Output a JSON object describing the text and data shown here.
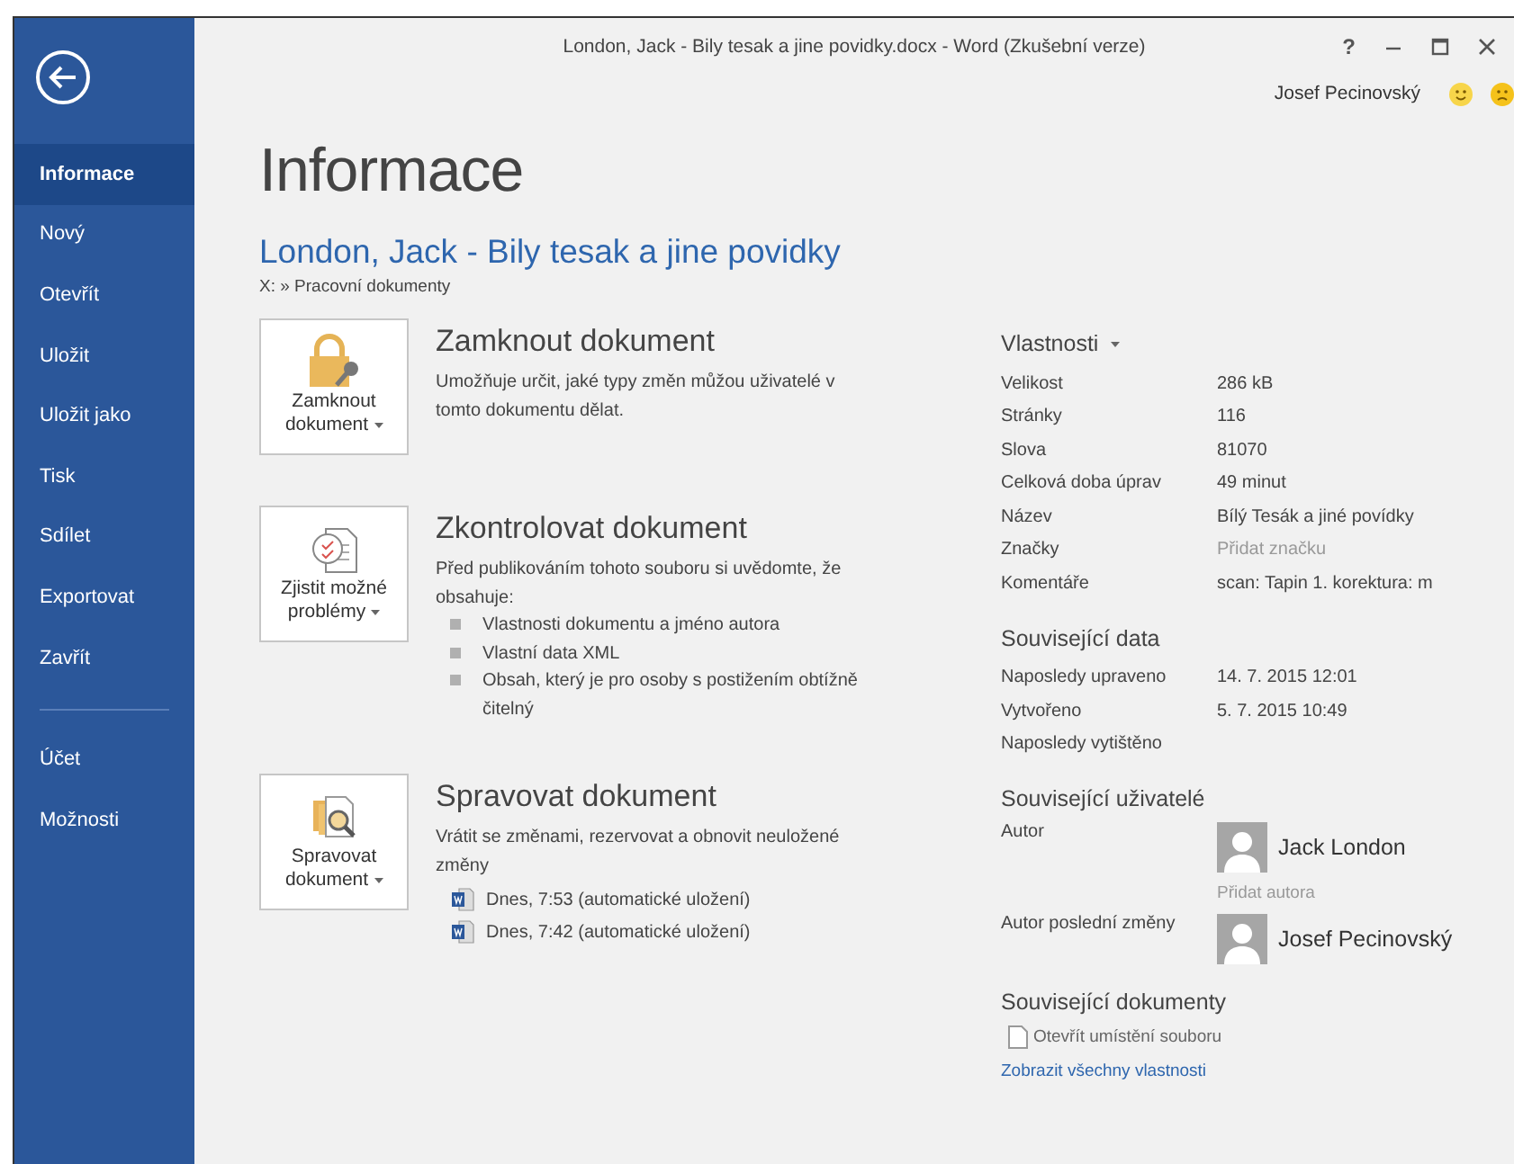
{
  "window": {
    "title": "London, Jack - Bily tesak a jine povidky.docx - Word (Zkušební verze)",
    "help": "?"
  },
  "user": {
    "name": "Josef Pecinovský"
  },
  "sidebar": {
    "items": [
      {
        "label": "Informace",
        "selected": true
      },
      {
        "label": "Nový",
        "selected": false
      },
      {
        "label": "Otevřít",
        "selected": false
      },
      {
        "label": "Uložit",
        "selected": false
      },
      {
        "label": "Uložit jako",
        "selected": false
      },
      {
        "label": "Tisk",
        "selected": false
      },
      {
        "label": "Sdílet",
        "selected": false
      },
      {
        "label": "Exportovat",
        "selected": false
      },
      {
        "label": "Zavřít",
        "selected": false
      }
    ],
    "bottom_items": [
      {
        "label": "Účet",
        "selected": false
      },
      {
        "label": "Možnosti",
        "selected": false
      }
    ]
  },
  "page": {
    "heading": "Informace",
    "document_title": "London, Jack - Bily tesak a jine povidky",
    "path": "X: » Pracovní dokumenty"
  },
  "sections": [
    {
      "kind": "lock",
      "button_label": "Zamknout dokument",
      "title": "Zamknout dokument",
      "description": "Umožňuje určit, jaké typy změn můžou uživatelé v tomto dokumentu dělat."
    },
    {
      "kind": "inspect",
      "button_label": "Zjistit možné problémy",
      "title": "Zkontrolovat dokument",
      "description": "Před publikováním tohoto souboru si uvědomte, že obsahuje:",
      "bullets": [
        "Vlastnosti dokumentu a jméno autora",
        "Vlastní data XML",
        "Obsah, který je pro osoby s postižením obtížně čitelný"
      ]
    },
    {
      "kind": "manage",
      "button_label": "Spravovat dokument",
      "title": "Spravovat dokument",
      "description": "Vrátit se změnami, rezervovat a obnovit neuložené změny",
      "versions": [
        "Dnes, 7:53 (automatické uložení)",
        "Dnes, 7:42 (automatické uložení)"
      ]
    }
  ],
  "properties": {
    "title": "Vlastnosti",
    "rows": [
      {
        "label": "Velikost",
        "value": "286 kB"
      },
      {
        "label": "Stránky",
        "value": "116"
      },
      {
        "label": "Slova",
        "value": "81070"
      },
      {
        "label": "Celková doba úprav",
        "value": "49 minut"
      },
      {
        "label": "Název",
        "value": "Bílý Tesák a jiné povídky"
      },
      {
        "label": "Značky",
        "placeholder": "Přidat značku"
      },
      {
        "label": "Komentáře",
        "value": "scan: Tapin 1. korektura: m"
      }
    ]
  },
  "related_dates": {
    "title": "Související data",
    "rows": [
      {
        "label": "Naposledy upraveno",
        "value": "14. 7. 2015 12:01"
      },
      {
        "label": "Vytvořeno",
        "value": "5. 7. 2015 10:49"
      },
      {
        "label": "Naposledy vytištěno"
      }
    ]
  },
  "related_people": {
    "title": "Související uživatelé",
    "rows": [
      {
        "label": "Autor",
        "person": "Jack London",
        "add_link": "Přidat autora"
      },
      {
        "label": "Autor poslední změny",
        "person": "Josef Pecinovský"
      }
    ]
  },
  "related_documents": {
    "title": "Související dokumenty",
    "open_location": "Otevřít umístění souboru",
    "show_all": "Zobrazit všechny vlastnosti"
  }
}
